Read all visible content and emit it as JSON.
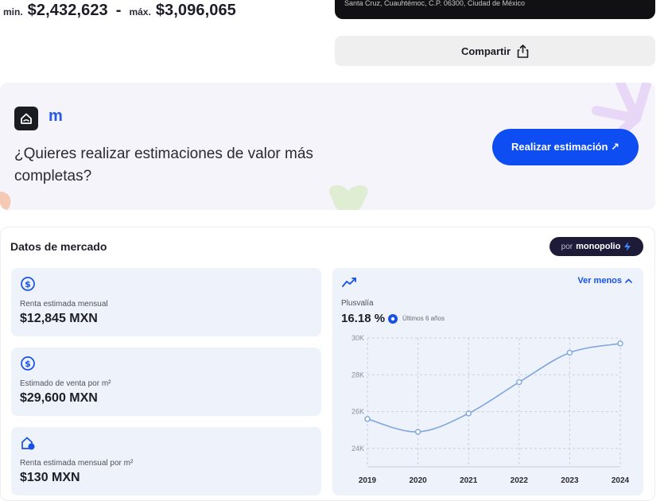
{
  "price_range": {
    "min_label": "min.",
    "min_value": "$2,432,623",
    "separator": "-",
    "max_label": "máx.",
    "max_value": "$3,096,065"
  },
  "address": "Santa Cruz, Cuauhtémoc, C.P. 06300, Ciudad de México",
  "share": {
    "label": "Compartir"
  },
  "promo": {
    "logo_letter": "m",
    "question": "¿Quieres realizar estimaciones de valor más completas?",
    "cta_label": "Realizar estimación ↗",
    "colors": {
      "cta": "#0d4df2",
      "background": "#f4f4fa"
    }
  },
  "market": {
    "title": "Datos de mercado",
    "badge": {
      "prefix": "por",
      "name": "monopolio"
    },
    "stats": [
      {
        "icon": "dollar-circle-icon",
        "label": "Renta estimada mensual",
        "value": "$12,845 MXN"
      },
      {
        "icon": "dollar-circle-icon",
        "label": "Estimado de venta por m²",
        "value": "$29,600 MXN"
      },
      {
        "icon": "house-dollar-icon",
        "label": "Renta estimada mensual por m²",
        "value": "$130 MXN"
      }
    ],
    "plusvalia": {
      "toggle_label": "Ver menos",
      "label": "Plusvalía",
      "value": "16.18 %",
      "period": "Últimos 6 años"
    }
  },
  "chart_data": {
    "type": "line",
    "x": [
      "2019",
      "2020",
      "2021",
      "2022",
      "2023",
      "2024"
    ],
    "series": [
      {
        "values": [
          25600,
          24900,
          25900,
          27600,
          29200,
          29700
        ]
      }
    ],
    "yticks": [
      "30K",
      "28K",
      "26K",
      "24K"
    ],
    "ytick_values": [
      30000,
      28000,
      26000,
      24000
    ],
    "ylim": [
      23000,
      30000
    ],
    "grid": true,
    "color": "#7fa6de"
  }
}
